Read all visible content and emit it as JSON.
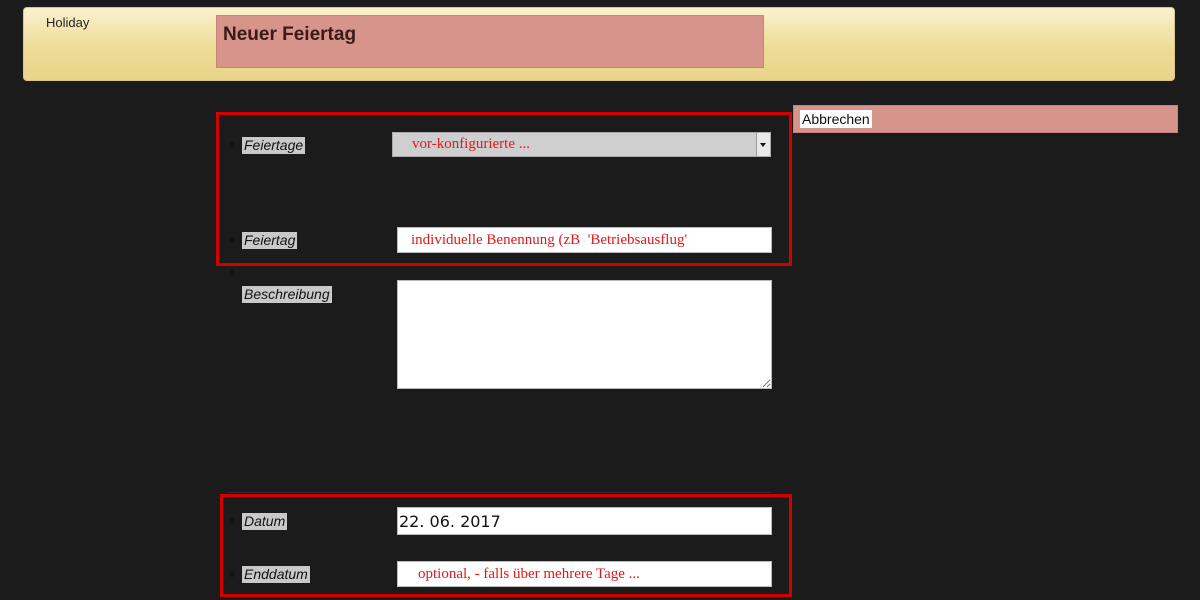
{
  "app": {
    "name": "Holiday"
  },
  "header": {
    "title": "Neuer Feiertag"
  },
  "actions": {
    "cancel_label": "Abbrechen"
  },
  "form": {
    "holidays": {
      "label": "Feiertage",
      "selected": "vor-konfigurierte  ..."
    },
    "holiday": {
      "label": "Feiertag",
      "placeholder": "individuelle Benennung (zB  'Betriebsausflug'"
    },
    "description": {
      "label": "Beschreibung",
      "value": ""
    },
    "date": {
      "label": "Datum",
      "value": "22. 06. 2017"
    },
    "end_date": {
      "label": "Enddatum",
      "placeholder": "optional, - falls über mehrere Tage ..."
    }
  },
  "colors": {
    "header_gradient": "#eedc97",
    "title_box": "#d6948b",
    "highlight_frame": "#d40000",
    "placeholder_text": "#e01818",
    "background": "#1b1b1b"
  }
}
